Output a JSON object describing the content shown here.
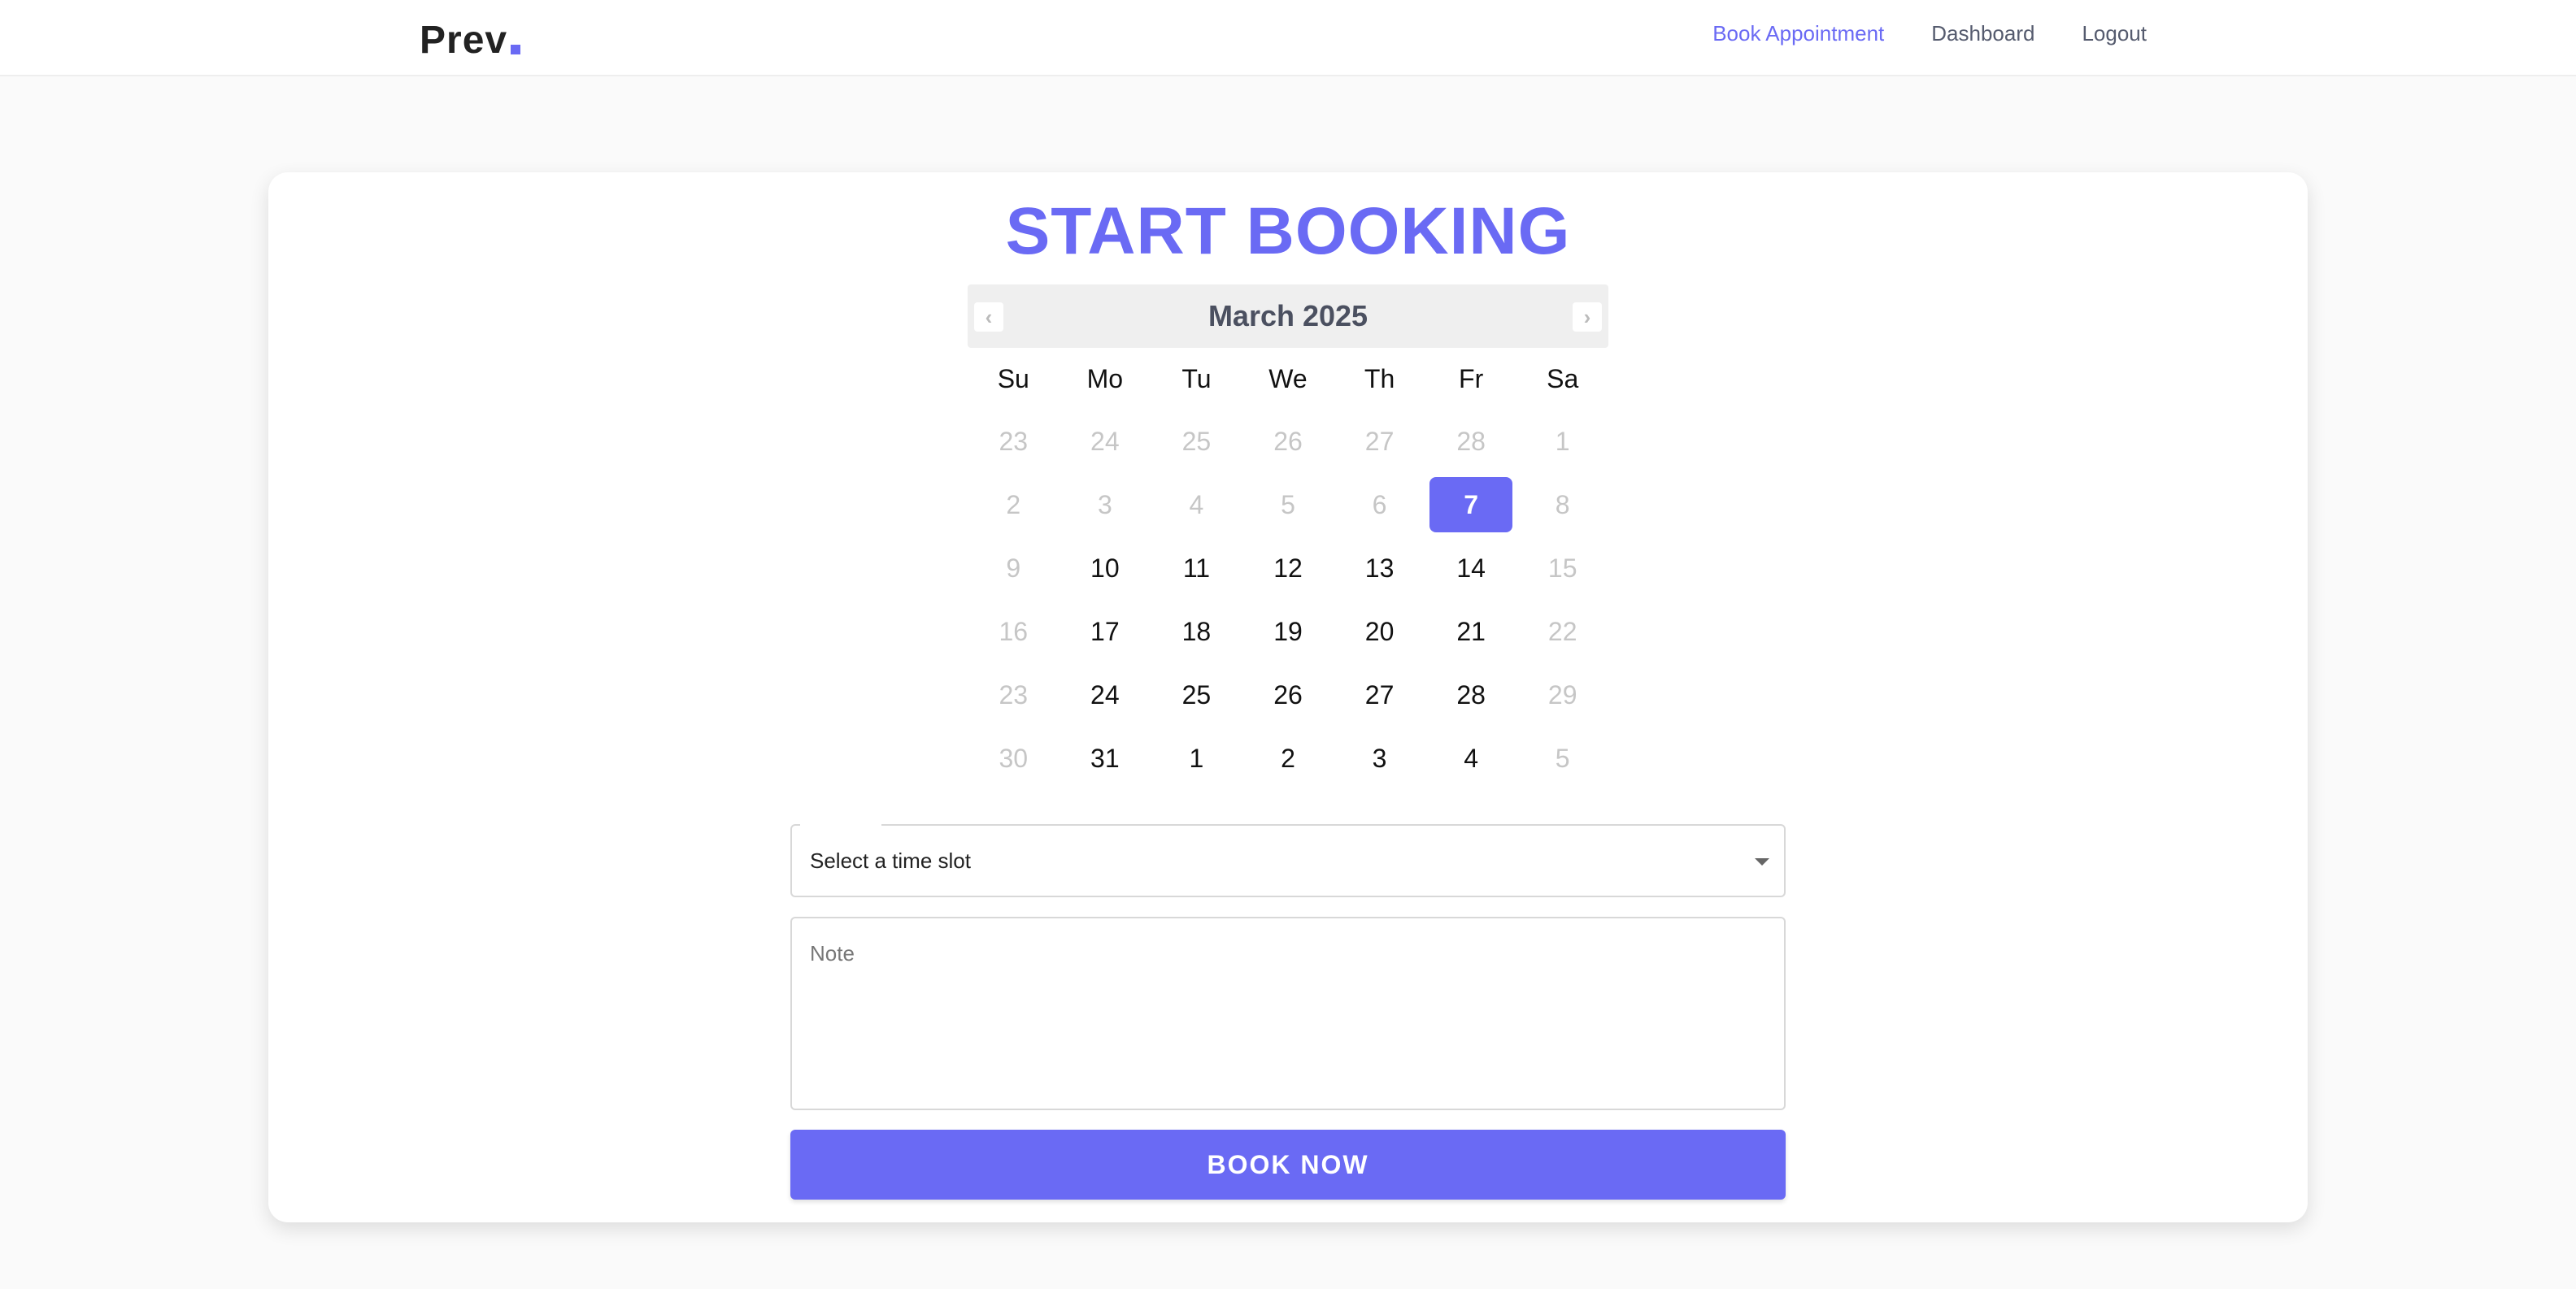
{
  "header": {
    "brand": "Prev",
    "nav": [
      {
        "label": "Book Appointment",
        "active": true
      },
      {
        "label": "Dashboard",
        "active": false
      },
      {
        "label": "Logout",
        "active": false
      }
    ]
  },
  "booking": {
    "title": "START BOOKING",
    "calendar": {
      "month_label": "March 2025",
      "prev_icon": "chevron-left-icon",
      "next_icon": "chevron-right-icon",
      "weekdays": [
        "Su",
        "Mo",
        "Tu",
        "We",
        "Th",
        "Fr",
        "Sa"
      ],
      "selected_day": "7",
      "weeks": [
        [
          {
            "d": "23",
            "m": true
          },
          {
            "d": "24",
            "m": true
          },
          {
            "d": "25",
            "m": true
          },
          {
            "d": "26",
            "m": true
          },
          {
            "d": "27",
            "m": true
          },
          {
            "d": "28",
            "m": true
          },
          {
            "d": "1",
            "m": true
          }
        ],
        [
          {
            "d": "2",
            "m": true
          },
          {
            "d": "3",
            "m": true
          },
          {
            "d": "4",
            "m": true
          },
          {
            "d": "5",
            "m": true
          },
          {
            "d": "6",
            "m": true
          },
          {
            "d": "7",
            "m": false,
            "sel": true
          },
          {
            "d": "8",
            "m": true
          }
        ],
        [
          {
            "d": "9",
            "m": true
          },
          {
            "d": "10",
            "m": false
          },
          {
            "d": "11",
            "m": false
          },
          {
            "d": "12",
            "m": false
          },
          {
            "d": "13",
            "m": false
          },
          {
            "d": "14",
            "m": false
          },
          {
            "d": "15",
            "m": true
          }
        ],
        [
          {
            "d": "16",
            "m": true
          },
          {
            "d": "17",
            "m": false
          },
          {
            "d": "18",
            "m": false
          },
          {
            "d": "19",
            "m": false
          },
          {
            "d": "20",
            "m": false
          },
          {
            "d": "21",
            "m": false
          },
          {
            "d": "22",
            "m": true
          }
        ],
        [
          {
            "d": "23",
            "m": true
          },
          {
            "d": "24",
            "m": false
          },
          {
            "d": "25",
            "m": false
          },
          {
            "d": "26",
            "m": false
          },
          {
            "d": "27",
            "m": false
          },
          {
            "d": "28",
            "m": false
          },
          {
            "d": "29",
            "m": true
          }
        ],
        [
          {
            "d": "30",
            "m": true
          },
          {
            "d": "31",
            "m": false
          },
          {
            "d": "1",
            "m": false
          },
          {
            "d": "2",
            "m": false
          },
          {
            "d": "3",
            "m": false
          },
          {
            "d": "4",
            "m": false
          },
          {
            "d": "5",
            "m": true
          }
        ]
      ]
    },
    "time_slot": {
      "value": "Select a time slot"
    },
    "note": {
      "placeholder": "Note"
    },
    "submit_label": "BOOK NOW"
  },
  "colors": {
    "accent": "#6a6af4",
    "muted_day": "#c6c6c6",
    "nav_text": "#555b6e"
  }
}
